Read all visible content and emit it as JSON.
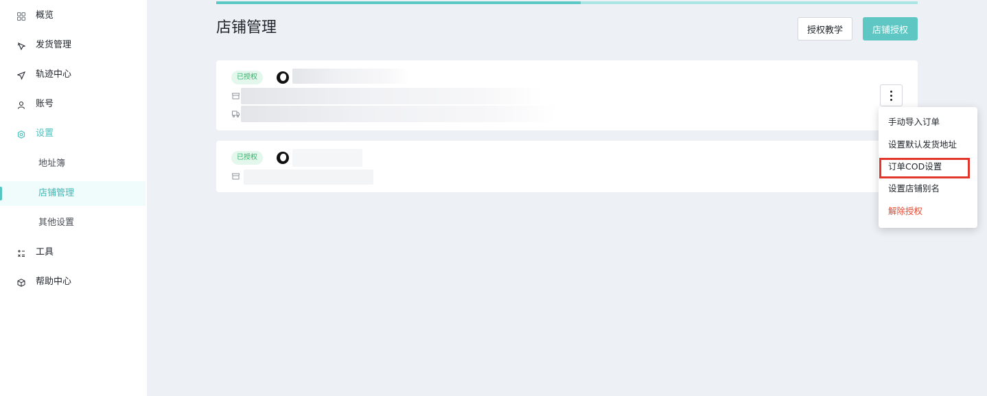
{
  "sidebar": {
    "items": [
      {
        "label": "概览",
        "icon": "grid-icon"
      },
      {
        "label": "发货管理",
        "icon": "truck-icon"
      },
      {
        "label": "轨迹中心",
        "icon": "send-icon"
      },
      {
        "label": "账号",
        "icon": "user-icon"
      },
      {
        "label": "设置",
        "icon": "settings-icon"
      },
      {
        "label": "地址簿"
      },
      {
        "label": "店铺管理"
      },
      {
        "label": "其他设置"
      },
      {
        "label": "工具",
        "icon": "calculator-icon"
      },
      {
        "label": "帮助中心",
        "icon": "box-icon"
      }
    ]
  },
  "progress": {
    "value": 0.52
  },
  "header": {
    "title": "店铺管理",
    "tutorial_button": "授权教学",
    "authorize_button": "店铺授权"
  },
  "stores": [
    {
      "status": "已授权"
    },
    {
      "status": "已授权"
    }
  ],
  "menu": {
    "items": [
      {
        "label": "手动导入订单"
      },
      {
        "label": "设置默认发货地址"
      },
      {
        "label": "订单COD设置"
      },
      {
        "label": "设置店铺别名"
      },
      {
        "label": "解除授权"
      }
    ]
  },
  "colors": {
    "accent": "#5ec7c3",
    "danger": "#e5482f",
    "badge_bg": "#e3f7ec",
    "badge_text": "#34b36a",
    "highlight": "#e2362c"
  }
}
